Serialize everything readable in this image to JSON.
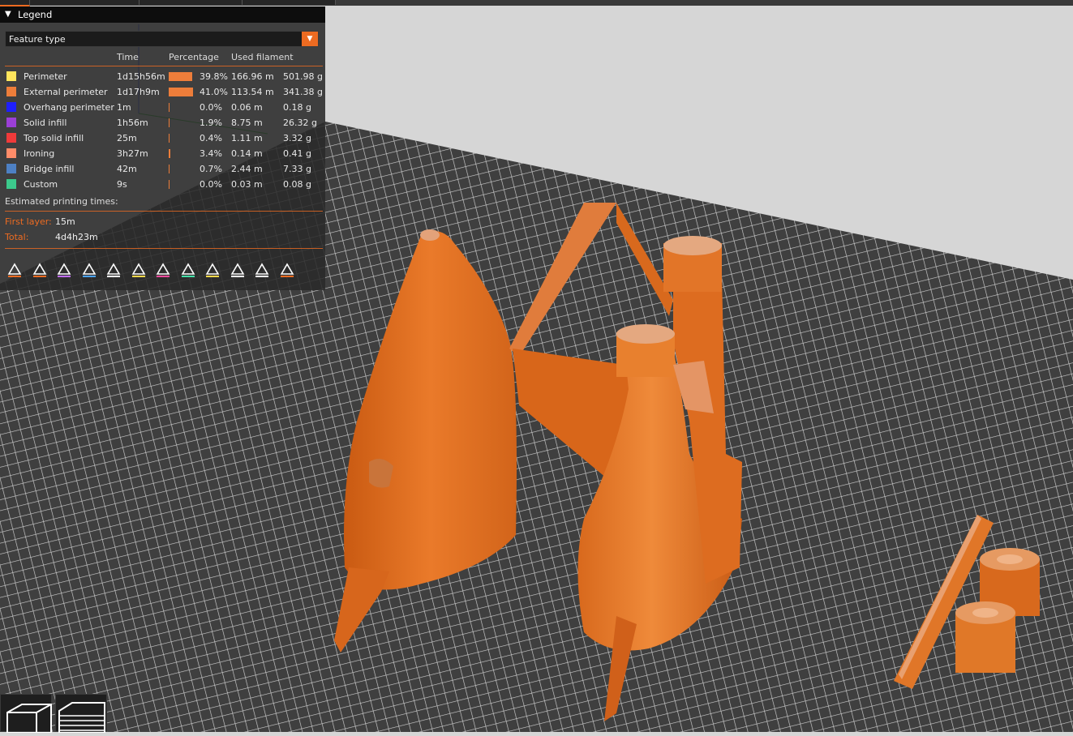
{
  "legend": {
    "title": "Legend",
    "view_type": "Feature type",
    "columns": {
      "time": "Time",
      "percentage": "Percentage",
      "used_filament": "Used filament"
    },
    "rows": [
      {
        "name": "Perimeter",
        "color": "#ffe55c",
        "time": "1d15h56m",
        "percentage": "39.8%",
        "pct_value": 39.8,
        "length": "166.96 m",
        "weight": "501.98 g"
      },
      {
        "name": "External perimeter",
        "color": "#ed7d3a",
        "time": "1d17h9m",
        "percentage": "41.0%",
        "pct_value": 41.0,
        "length": "113.54 m",
        "weight": "341.38 g"
      },
      {
        "name": "Overhang perimeter",
        "color": "#1f1fff",
        "time": "1m",
        "percentage": "0.0%",
        "pct_value": 0.0,
        "length": "0.06 m",
        "weight": "0.18 g"
      },
      {
        "name": "Solid infill",
        "color": "#9b3fd6",
        "time": "1h56m",
        "percentage": "1.9%",
        "pct_value": 1.9,
        "length": "8.75 m",
        "weight": "26.32 g"
      },
      {
        "name": "Top solid infill",
        "color": "#f03a3a",
        "time": "25m",
        "percentage": "0.4%",
        "pct_value": 0.4,
        "length": "1.11 m",
        "weight": "3.32 g"
      },
      {
        "name": "Ironing",
        "color": "#ff8c69",
        "time": "3h27m",
        "percentage": "3.4%",
        "pct_value": 3.4,
        "length": "0.14 m",
        "weight": "0.41 g"
      },
      {
        "name": "Bridge infill",
        "color": "#4d80c4",
        "time": "42m",
        "percentage": "0.7%",
        "pct_value": 0.7,
        "length": "2.44 m",
        "weight": "7.33 g"
      },
      {
        "name": "Custom",
        "color": "#3cc98c",
        "time": "9s",
        "percentage": "0.0%",
        "pct_value": 0.0,
        "length": "0.03 m",
        "weight": "0.08 g"
      }
    ],
    "estimated_label": "Estimated printing times:",
    "first_layer_label": "First layer:",
    "first_layer_value": "15m",
    "total_label": "Total:",
    "total_value": "4d4h23m",
    "toolbar_icons": [
      "travel-icon",
      "wipe-icon",
      "retractions-icon",
      "deretractions-icon",
      "seams-icon",
      "tool-changes-icon",
      "color-changes-icon",
      "pause-prints-icon",
      "custom-gcode-icon",
      "center-of-gravity-icon",
      "shells-icon",
      "tool-marker-icon"
    ]
  },
  "colors": {
    "accent": "#ed6b21",
    "model": "#e06f1e",
    "bed": "#3c3c3c",
    "background": "#d6d6d6"
  },
  "view_buttons": [
    "3d-view-icon",
    "preview-layers-icon"
  ]
}
